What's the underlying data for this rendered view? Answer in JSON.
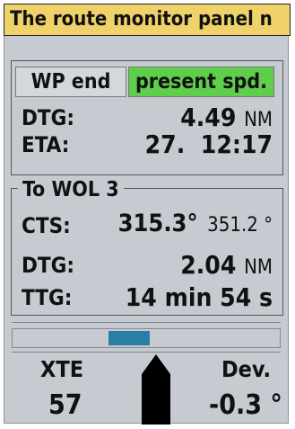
{
  "title": "The route monitor panel n",
  "tabs": {
    "wp_end": "WP end",
    "present_spd": "present spd."
  },
  "summary": {
    "dtg_label": "DTG:",
    "dtg_value": "4.49",
    "dtg_unit": "NM",
    "eta_label": "ETA:",
    "eta_value": "27.  12:17"
  },
  "to_section": {
    "title": "To WOL 3",
    "cts_label": "CTS:",
    "cts_value": "315.3°",
    "cts_secondary": "351.2 °",
    "dtg_label": "DTG:",
    "dtg_value": "2.04",
    "dtg_unit": "NM",
    "ttg_label": "TTG:",
    "ttg_value": "14 min 54 s"
  },
  "xte": {
    "label": "XTE",
    "value": "57"
  },
  "dev": {
    "label": "Dev.",
    "value": "-0.3 °"
  },
  "colors": {
    "title_bg": "#f0d26b",
    "present_spd_bg": "#5fce4b",
    "track_marker": "#2a7ea6"
  },
  "icons": {
    "ship": "ship-heading-icon"
  }
}
